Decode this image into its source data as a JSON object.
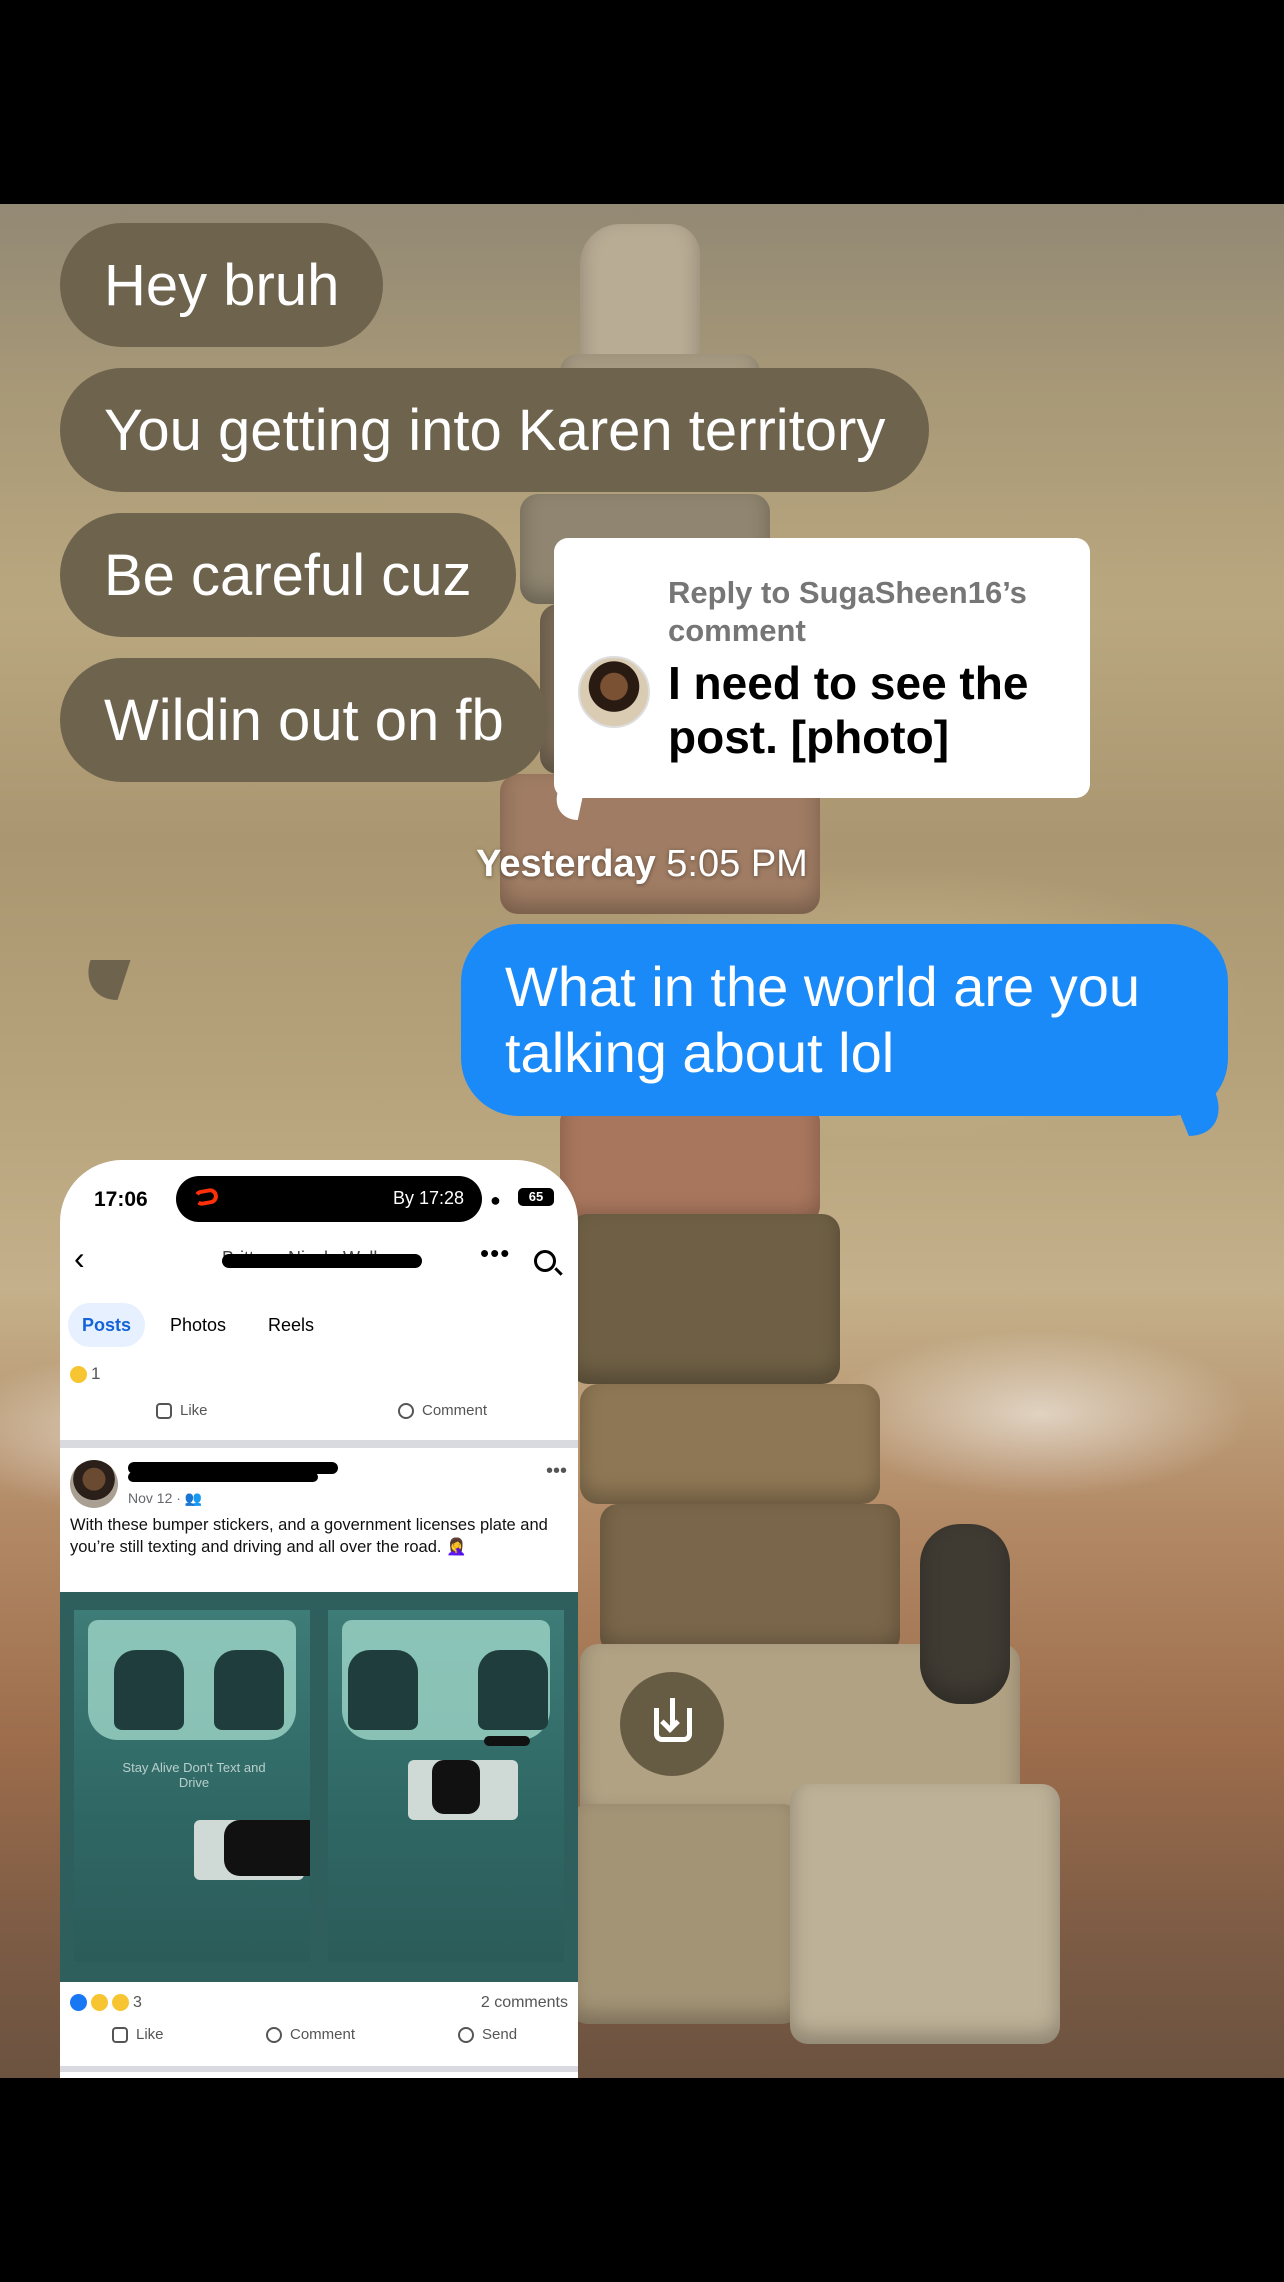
{
  "messages_in": [
    "Hey bruh",
    "You getting into Karen territory",
    "Be careful cuz",
    "Wildin out on fb"
  ],
  "reply": {
    "label": "Reply to SugaSheen16’s comment",
    "text": "I need to see the post. [photo]"
  },
  "timestamp": {
    "day": "Yesterday",
    "time": "5:05 PM"
  },
  "message_out": "What in the world are you talking about lol",
  "colors": {
    "bubble_in": "#6e644e",
    "bubble_out": "#1a8af8"
  },
  "embedded_screenshot": {
    "status": {
      "time": "17:06",
      "island_text": "By 17:28",
      "battery": "65"
    },
    "profile_name": "Brittany Nicole Walls",
    "tabs": [
      "Posts",
      "Photos",
      "Reels"
    ],
    "top_reaction_count": "1",
    "actions": {
      "like": "Like",
      "comment": "Comment",
      "send": "Send"
    },
    "post": {
      "date": "Nov 12 · 👥",
      "text": "With these bumper stickers, and a government licenses plate and you’re still texting and driving and all over the road. 🤦‍♀️",
      "sticker_text": "Stay Alive Don't Text and Drive",
      "reaction_count": "3",
      "comments": "2 comments"
    }
  },
  "icons": {
    "back": "chevron-left-icon",
    "more": "more-dots-icon",
    "search": "search-icon",
    "download": "download-icon"
  }
}
